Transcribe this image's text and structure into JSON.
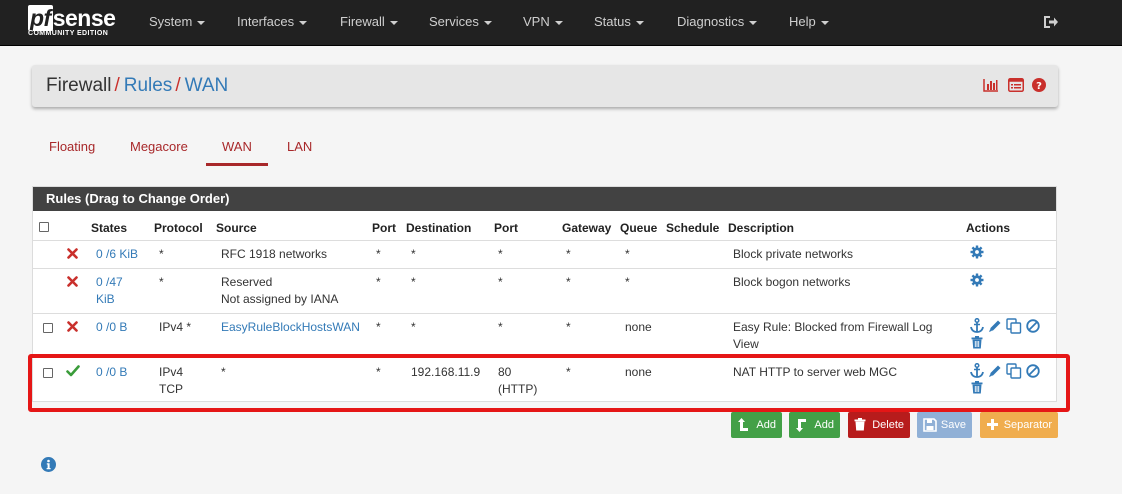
{
  "app": {
    "logo_main": "sense",
    "logo_pf": "pf",
    "logo_sub": "COMMUNITY EDITION"
  },
  "nav": {
    "items": [
      {
        "label": "System"
      },
      {
        "label": "Interfaces"
      },
      {
        "label": "Firewall"
      },
      {
        "label": "Services"
      },
      {
        "label": "VPN"
      },
      {
        "label": "Status"
      },
      {
        "label": "Diagnostics"
      },
      {
        "label": "Help"
      }
    ],
    "logout_icon": "sign-out-icon"
  },
  "breadcrumb": {
    "root": "Firewall",
    "sep": "/",
    "level1": "Rules",
    "level2": "WAN",
    "icons": [
      "chart-bar-icon",
      "list-alt-icon",
      "question-circle-icon"
    ]
  },
  "tabs": [
    {
      "label": "Floating",
      "active": false
    },
    {
      "label": "Megacore",
      "active": false
    },
    {
      "label": "WAN",
      "active": true
    },
    {
      "label": "LAN",
      "active": false
    }
  ],
  "rules_table": {
    "title": "Rules (Drag to Change Order)",
    "headers": {
      "states": "States",
      "protocol": "Protocol",
      "source": "Source",
      "port": "Port",
      "destination": "Destination",
      "dport": "Port",
      "gateway": "Gateway",
      "queue": "Queue",
      "schedule": "Schedule",
      "description": "Description",
      "actions": "Actions"
    },
    "rows": [
      {
        "action": "block",
        "states_a": "0 /6 KiB",
        "states_b": "",
        "protocol_a": "*",
        "protocol_b": "",
        "source_a": "RFC 1918 networks",
        "source_b": "",
        "port": "*",
        "destination": "*",
        "dport_a": "*",
        "dport_b": "",
        "gateway": "*",
        "queue": "*",
        "schedule": "",
        "desc_a": "Block private networks",
        "desc_b": ""
      },
      {
        "action": "block",
        "states_a": "0 /47",
        "states_b": "KiB",
        "protocol_a": "*",
        "protocol_b": "",
        "source_a": "Reserved",
        "source_b": "Not assigned by IANA",
        "port": "*",
        "destination": "*",
        "dport_a": "*",
        "dport_b": "",
        "gateway": "*",
        "queue": "*",
        "schedule": "",
        "desc_a": "Block bogon networks",
        "desc_b": ""
      },
      {
        "action": "block",
        "states_a": "0 /0 B",
        "states_b": "",
        "protocol_a": "IPv4 *",
        "protocol_b": "",
        "source_a": "EasyRuleBlockHostsWAN",
        "source_b": "",
        "port": "*",
        "destination": "*",
        "dport_a": "*",
        "dport_b": "",
        "gateway": "*",
        "queue": "none",
        "schedule": "",
        "desc_a": "Easy Rule: Blocked from Firewall Log",
        "desc_b": "View"
      },
      {
        "action": "pass",
        "states_a": "0 /0 B",
        "states_b": "",
        "protocol_a": "IPv4",
        "protocol_b": "TCP",
        "source_a": "*",
        "source_b": "",
        "port": "*",
        "destination": "192.168.11.9",
        "dport_a": "80",
        "dport_b": "(HTTP)",
        "gateway": "*",
        "queue": "none",
        "schedule": "",
        "desc_a": "NAT HTTP to server web MGC",
        "desc_b": ""
      }
    ]
  },
  "buttons": {
    "add_top": "Add",
    "add_bottom": "Add",
    "delete": "Delete",
    "save": "Save",
    "separator": "Separator"
  },
  "colors": {
    "navbar_bg": "#212121",
    "link": "#337ab7",
    "tab_active": "#a8282a",
    "block": "#c9302c",
    "pass": "#3a9c3a",
    "btn_add": "#43a047",
    "btn_delete": "#b71c1c",
    "btn_save": "#90b0d6",
    "btn_separator": "#f0ad4e",
    "highlight": "#e51616"
  }
}
